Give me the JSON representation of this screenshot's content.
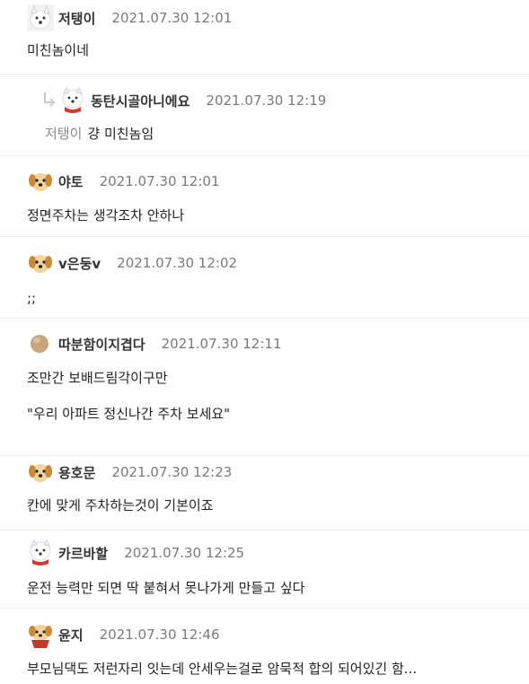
{
  "comments": [
    {
      "nick": "저탱이",
      "date": "2021.07.30 12:01",
      "avatar": "white-dog-icon",
      "body": "미친놈이네"
    },
    {
      "nick": "동탄시골아니에요",
      "date": "2021.07.30 12:19",
      "avatar": "white-dog-scarf-icon",
      "reply_to": "저탱이",
      "body": "걍 미친놈임"
    },
    {
      "nick": "야토",
      "date": "2021.07.30 12:01",
      "avatar": "puppy-icon",
      "body": "정면주차는 생각조차 안하나"
    },
    {
      "nick": "v은둥v",
      "date": "2021.07.30 12:02",
      "avatar": "puppy-icon",
      "body": ";;"
    },
    {
      "nick": "따분함이지겹다",
      "date": "2021.07.30 12:11",
      "avatar": "egg-icon",
      "body": "조만간 보배드림각이구만\n\n\"우리 아파트 정신나간 주차 보세요\""
    },
    {
      "nick": "용호문",
      "date": "2021.07.30 12:23",
      "avatar": "puppy-icon",
      "body": "칸에 맞게 주차하는것이 기본이죠"
    },
    {
      "nick": "카르바할",
      "date": "2021.07.30 12:25",
      "avatar": "white-dog-scarf-icon",
      "body": "운전 능력만 되면 딱 붙혀서 못나가게 만들고 싶다"
    },
    {
      "nick": "윤지",
      "date": "2021.07.30 12:46",
      "avatar": "puppy-cape-icon",
      "body": "부모님댁도 저런자리 잇는데 안세우는걸로 암묵적 합의 되어있긴 함..."
    }
  ],
  "colors": {
    "border": "#ececec",
    "date": "#7a7a7a",
    "reply_arrow": "#c9c9c9"
  }
}
